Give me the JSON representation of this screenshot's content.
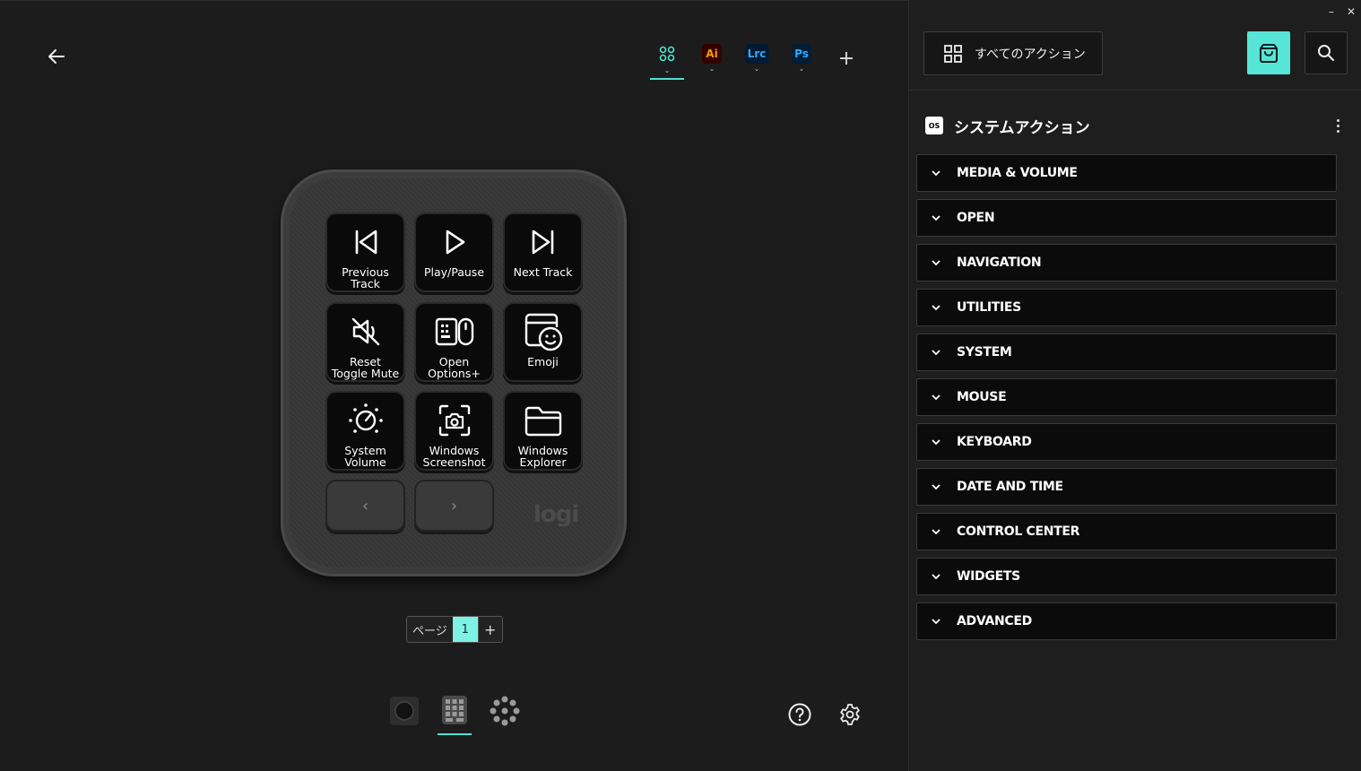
{
  "header": {
    "profiles": [
      {
        "id": "all",
        "label": "",
        "icon": "grid-dots-icon",
        "active": true
      },
      {
        "id": "ai",
        "label": "Ai",
        "color": "#ff9a00"
      },
      {
        "id": "lrc",
        "label": "Lrc",
        "color": "#31a8ff"
      },
      {
        "id": "ps",
        "label": "Ps",
        "color": "#31a8ff"
      }
    ],
    "add_profile_label": "+"
  },
  "device": {
    "keys": [
      {
        "label": "Previous Track",
        "icon": "previous-track-icon"
      },
      {
        "label": "Play/Pause",
        "icon": "play-icon"
      },
      {
        "label": "Next Track",
        "icon": "next-track-icon"
      },
      {
        "label": "Reset Toggle Mute",
        "icon": "mute-icon"
      },
      {
        "label": "Open Options+",
        "icon": "options-icon"
      },
      {
        "label": "Emoji",
        "icon": "emoji-icon"
      },
      {
        "label": "System Volume",
        "icon": "volume-dial-icon"
      },
      {
        "label": "Windows Screenshot",
        "icon": "screenshot-icon"
      },
      {
        "label": "Windows Explorer",
        "icon": "folder-icon"
      }
    ],
    "prev_page": "‹",
    "next_page": "›",
    "logo": "logi"
  },
  "pager": {
    "label": "ページ",
    "current": "1",
    "add": "+"
  },
  "panel": {
    "all_actions_label": "すべてのアクション",
    "section_badge": "OS",
    "section_title": "システムアクション",
    "categories": [
      "MEDIA & VOLUME",
      "OPEN",
      "NAVIGATION",
      "UTILITIES",
      "SYSTEM",
      "MOUSE",
      "KEYBOARD",
      "DATE AND TIME",
      "CONTROL CENTER",
      "WIDGETS",
      "ADVANCED"
    ],
    "window_minimize": "–",
    "window_close": "✕"
  },
  "colors": {
    "accent": "#4ee0d2",
    "store_button": "#56e5d6",
    "page_active": "#7ef2e5"
  }
}
